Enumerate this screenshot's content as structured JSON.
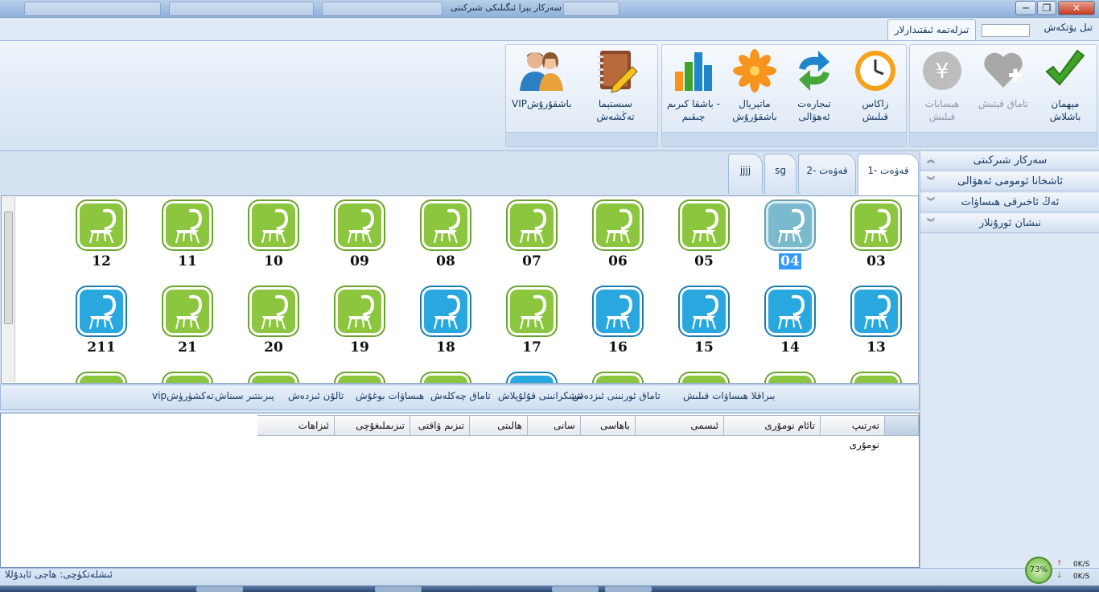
{
  "window": {
    "title": "سەركار يېزا ئىگىلىكى شىركىتى",
    "buttons": {
      "minimize": "─",
      "maximize": "❐",
      "close": "✕"
    }
  },
  "menubar": {
    "language_label": "تىل يۆتكەش",
    "ribbon_tab": "تىزلەتمە ئىقتىدارلار"
  },
  "ribbon": {
    "buttons": [
      {
        "label": "مېھمان\nباشلاش",
        "icon": "checkmark-icon",
        "enabled": true
      },
      {
        "label": "تاماق قېتىش",
        "icon": "heart-plus-icon",
        "enabled": false
      },
      {
        "label": "ھېسابات\nقىلىش",
        "icon": "yen-coin-icon",
        "enabled": false
      },
      {
        "label": "زاكاس\nقىلىش",
        "icon": "clock-icon",
        "enabled": true
      },
      {
        "label": "تىجارەت\nئەھۋالى",
        "icon": "refresh-arrows-icon",
        "enabled": true
      },
      {
        "label": "ماتېريال\nباشقۇرۇش",
        "icon": "flower-icon",
        "enabled": true
      },
      {
        "label": "باشقا كىرىم -\nچىقىم",
        "icon": "bar-chart-icon",
        "enabled": true
      },
      {
        "label": "سىستېما تەڭشەش",
        "icon": "notebook-pencil-icon",
        "enabled": true
      },
      {
        "label": "VIPباشقۇرۇش",
        "icon": "users-icon",
        "enabled": true
      }
    ]
  },
  "right_panel": {
    "items": [
      {
        "label": "سەركار شىركىتى",
        "chevron": "︽"
      },
      {
        "label": "ئاشخانا ئومومى ئەھۋالى",
        "chevron": "︾"
      },
      {
        "label": "ئەڭ ئاخىرقى ھىساۋات",
        "chevron": "︾"
      },
      {
        "label": "نىشان ئورۇنلار",
        "chevron": "︾"
      }
    ]
  },
  "doc_tabs": [
    "قەۋەت -1",
    "قەۋەت -2",
    "sg",
    "jjjj"
  ],
  "rooms": {
    "row1": [
      {
        "num": "03",
        "state": "free"
      },
      {
        "num": "04",
        "state": "selected"
      },
      {
        "num": "05",
        "state": "free"
      },
      {
        "num": "06",
        "state": "free"
      },
      {
        "num": "07",
        "state": "free"
      },
      {
        "num": "08",
        "state": "free"
      },
      {
        "num": "09",
        "state": "free"
      },
      {
        "num": "10",
        "state": "free"
      },
      {
        "num": "11",
        "state": "free"
      },
      {
        "num": "12",
        "state": "free"
      }
    ],
    "row2": [
      {
        "num": "13",
        "state": "busy"
      },
      {
        "num": "14",
        "state": "busy"
      },
      {
        "num": "15",
        "state": "busy"
      },
      {
        "num": "16",
        "state": "busy"
      },
      {
        "num": "17",
        "state": "free"
      },
      {
        "num": "18",
        "state": "busy"
      },
      {
        "num": "19",
        "state": "free"
      },
      {
        "num": "20",
        "state": "free"
      },
      {
        "num": "21",
        "state": "free"
      },
      {
        "num": "211",
        "state": "busy"
      }
    ]
  },
  "action_bar": [
    "بىراقلا ھىساۋات قىلىش",
    "تاماق ئورنىنى ئىزدەش",
    "ئىشكرانىنى قۇلۇپلاش",
    "تاماق چەكلەش",
    "ھىساۋات بوغۇش",
    "تالۇن ئىزدەش",
    "پىرىنتىر سىناش",
    "vipتەكشۈرۈش"
  ],
  "table": {
    "columns": [
      "تەرتىپ نومۇرى",
      "تائام نومۇرى",
      "ئىسمى",
      "باھاسى",
      "سانى",
      "ھالىتى",
      "تىزىم ۋاقتى",
      "تىزىملىغۇچى",
      "ئىزاھات"
    ]
  },
  "status": {
    "operator": "ئىشلەتكۈچى:  ھاجى ئابدۇللا",
    "cpu": "73%",
    "up_speed": "0K/S",
    "down_speed": "0K/S"
  },
  "colors": {
    "free": "#8cc63f",
    "busy": "#29a8df",
    "selected_num": "#3399ff"
  }
}
